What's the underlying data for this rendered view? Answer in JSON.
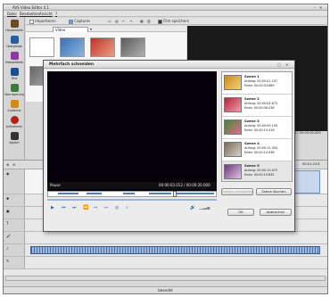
{
  "app": {
    "title": "AVS Video Editor 4.1"
  },
  "menu": [
    "Datei",
    "Bearbeiten",
    "Ansicht",
    "?"
  ],
  "left_nav": [
    {
      "label": "Hauptmedia",
      "icon": "film-reel-icon",
      "color": "#6b4a2a"
    },
    {
      "label": "Übergänge",
      "icon": "transition-icon",
      "color": "#2a5c9e"
    },
    {
      "label": "Videoeffekte",
      "icon": "video-effects-icon",
      "color": "#8a3a9e"
    },
    {
      "label": "Text",
      "icon": "text-icon",
      "color": "#1f4e8c"
    },
    {
      "label": "Überlagerung",
      "icon": "overlay-icon",
      "color": "#3c7a3c"
    },
    {
      "label": "Audiomix",
      "icon": "audio-mix-icon",
      "color": "#d08a1a"
    },
    {
      "label": "Aufnehmen",
      "icon": "record-icon",
      "color": "#b02020"
    },
    {
      "label": "Kapitel",
      "icon": "chapter-icon",
      "color": "#333333"
    }
  ],
  "toolbar": {
    "import_label": "Importieren",
    "captures_label": "Captures",
    "filter_value": "Video",
    "save_label": "Film speichern"
  },
  "preview": {
    "timecode": "00:00:00.000 / 00:00:00.000"
  },
  "timeline": {
    "ruler_time": "00:01:23.6"
  },
  "status": {
    "text": "beendet"
  },
  "dialog": {
    "title": "Mehrfach schneiden",
    "state": "Pause",
    "timecode": "00:00:03.012 / 00:00:20.000",
    "remove_scene_label": "Szenen verwerfen",
    "delete_scene_label": "Szene löschen",
    "ok_label": "OK",
    "cancel_label": "Abbrechen",
    "scenes": [
      {
        "name": "Szene 1",
        "start": "Anfang: 00:00:01.247",
        "end": "Ende:    00:00:03.689",
        "color": "#c98a1e",
        "selected": false
      },
      {
        "name": "Szene 2",
        "start": "Anfang: 00:00:04.673",
        "end": "Ende:    00:00:06.436",
        "color": "#b5243a",
        "selected": false
      },
      {
        "name": "Szene 3",
        "start": "Anfang: 00:00:09.109",
        "end": "Ende:    00:00:10.416",
        "color": "#3c8a3a",
        "selected": false
      },
      {
        "name": "Szene 4",
        "start": "Anfang: 00:00:12.354",
        "end": "Ende:    00:00:14.936",
        "color": "#7a6a5a",
        "selected": false
      },
      {
        "name": "Szene 5",
        "start": "Anfang: 00:00:15.475",
        "end": "Ende:    00:00:19.832",
        "color": "#6a3a7a",
        "selected": true
      }
    ]
  }
}
